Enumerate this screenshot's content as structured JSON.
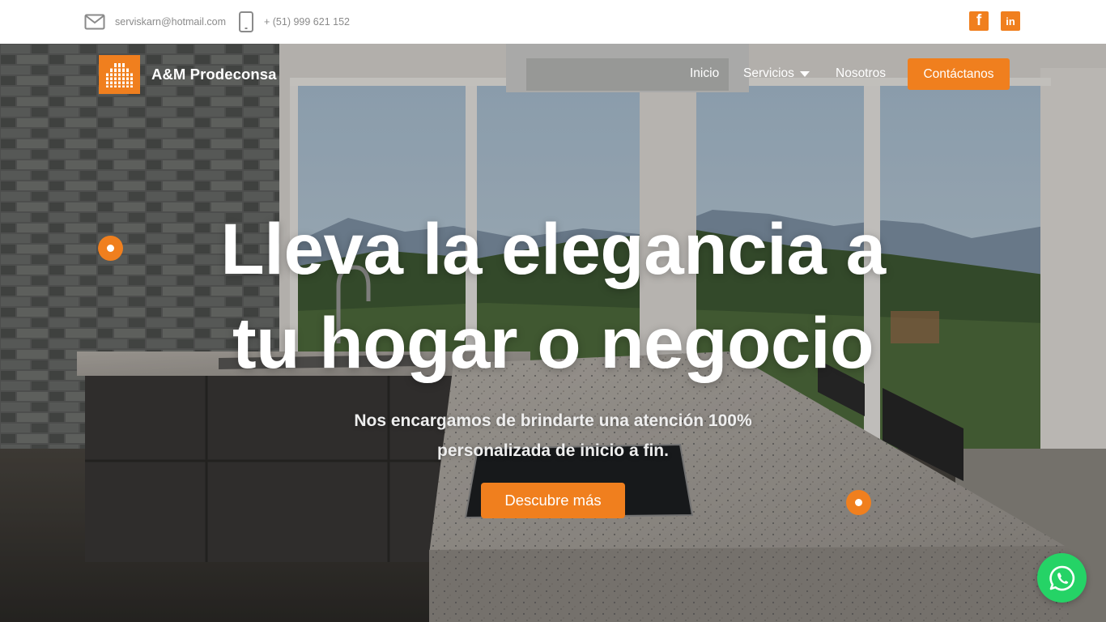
{
  "contact": {
    "email": "serviskarn@hotmail.com",
    "phone": "+ (51) 999 621 152"
  },
  "social": {
    "facebook_glyph": "f",
    "linkedin_glyph": "in"
  },
  "brand": {
    "name": "A&M Prodeconsa",
    "logo_icon": "building-icon"
  },
  "nav": {
    "inicio": "Inicio",
    "servicios": "Servicios",
    "nosotros": "Nosotros",
    "contact": "Contáctanos"
  },
  "hero": {
    "title_line1": "Lleva la elegancia a",
    "title_line2": "tu hogar o negocio",
    "subtitle_line1": "Nos encargamos de brindarte una atención 100%",
    "subtitle_line2": "personalizada de inicio a fin.",
    "cta": "Descubre más"
  },
  "colors": {
    "accent": "#f07f1e",
    "whatsapp": "#25d366"
  }
}
